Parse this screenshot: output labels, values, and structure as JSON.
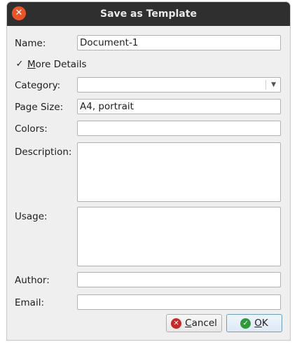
{
  "window": {
    "title": "Save as Template",
    "close_glyph": "✕",
    "close_icon": "close-icon"
  },
  "labels": {
    "name": "Name:",
    "category": "Category:",
    "page_size": "Page Size:",
    "colors": "Colors:",
    "description": "Description:",
    "usage": "Usage:",
    "author": "Author:",
    "email": "Email:"
  },
  "fields": {
    "name": "Document-1",
    "category": "",
    "page_size": "A4, portrait",
    "colors": "",
    "description": "",
    "usage": "",
    "author": "",
    "email": ""
  },
  "more_details": {
    "checked": true,
    "mark": "✓",
    "mnemonic": "M",
    "rest": "ore Details"
  },
  "combo": {
    "arrow": "▼"
  },
  "buttons": {
    "cancel": {
      "mnemonic": "C",
      "rest": "ancel",
      "icon_glyph": "✕",
      "icon": "cancel-icon"
    },
    "ok": {
      "mnemonic": "O",
      "rest": "K",
      "icon_glyph": "✓",
      "icon": "ok-icon"
    }
  },
  "colors": {
    "titlebar": "#2f2f2f",
    "close": "#e9542a",
    "cancel_icon": "#c62828",
    "ok_icon": "#2e9b3a"
  }
}
